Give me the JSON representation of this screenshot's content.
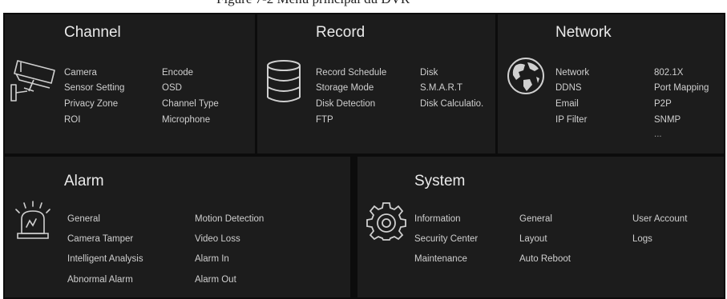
{
  "caption": "Figure 7-2 Menu principal du DVR",
  "panels": {
    "channel": {
      "title": "Channel",
      "icon": "camera-icon",
      "items": [
        "Camera",
        "Encode",
        "Sensor Setting",
        "OSD",
        "Privacy Zone",
        "Channel Type",
        "ROI",
        "Microphone"
      ]
    },
    "record": {
      "title": "Record",
      "icon": "database-icon",
      "items": [
        "Record Schedule",
        "Disk",
        "Storage Mode",
        "S.M.A.R.T",
        "Disk Detection",
        "Disk Calculatio.",
        "FTP"
      ]
    },
    "network": {
      "title": "Network",
      "icon": "globe-icon",
      "items": [
        "Network",
        "802.1X",
        "DDNS",
        "Port Mapping",
        "Email",
        "P2P",
        "IP Filter",
        "SNMP"
      ],
      "more": "..."
    },
    "alarm": {
      "title": "Alarm",
      "icon": "alarm-siren-icon",
      "items": [
        "General",
        "Motion Detection",
        "Camera Tamper",
        "Video Loss",
        "Intelligent Analysis",
        "Alarm In",
        "Abnormal Alarm",
        "Alarm Out"
      ]
    },
    "system": {
      "title": "System",
      "icon": "gear-icon",
      "items": [
        "Information",
        "General",
        "User Account",
        "Security Center",
        "Layout",
        "Logs",
        "Maintenance",
        "Auto Reboot"
      ]
    }
  }
}
